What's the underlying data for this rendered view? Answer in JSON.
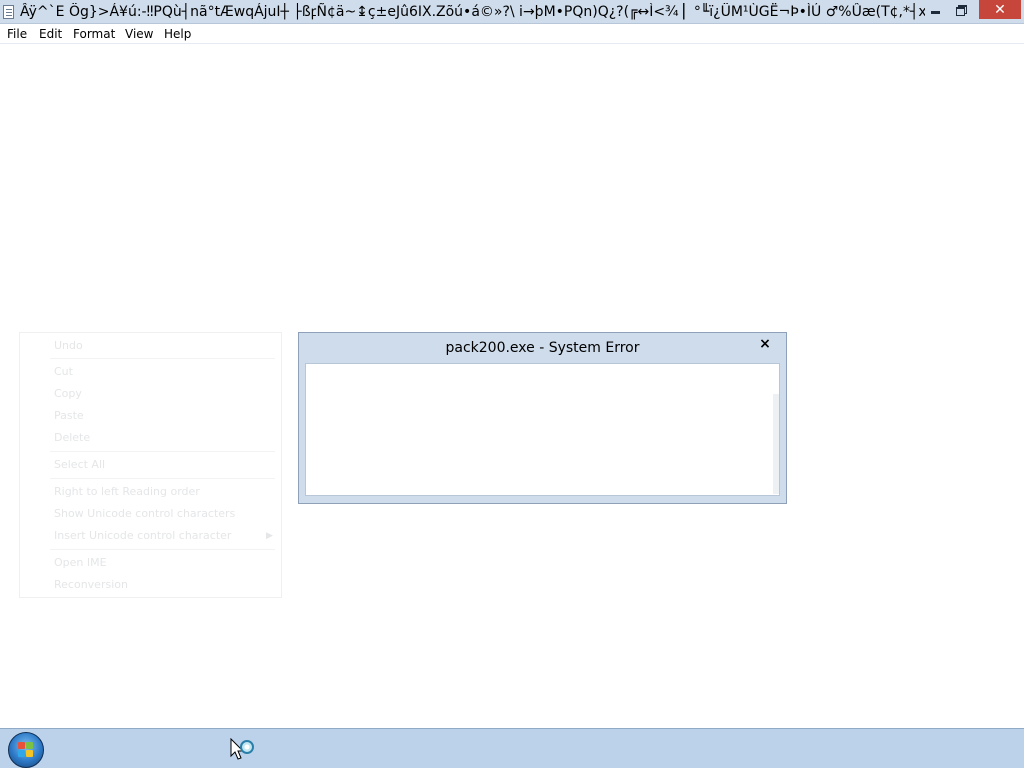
{
  "window": {
    "title": "Âÿ^`E Ög}>Á¥ú:-‼PQù┤nã°tÆwqÁjuI┼ ├ßꝼÑ¢ä~↨ç±eJû6IX.Zõú•á©»?\\ i→þM•PQn)Q¿?(╔↔Ì<¾ ▏°╙ï¿ÜM¹ÙGË¬Þ•ÌÚ ♂%Ûæ(T¢,*┤xómÓES...",
    "close_glyph": "✕"
  },
  "menubar": {
    "items": [
      "File",
      "Edit",
      "Format",
      "View",
      "Help"
    ]
  },
  "context_menu": {
    "items": [
      "Undo",
      "Cut",
      "Copy",
      "Paste",
      "Delete",
      "Select All",
      "Right to left Reading order",
      "Show Unicode control characters",
      "Insert Unicode control character",
      "Open IME",
      "Reconversion"
    ]
  },
  "dialog": {
    "title": "pack200.exe - System Error",
    "close_glyph": "×"
  },
  "taskbar": {
    "start_icon": "windows-logo-icon",
    "cursor_icon": "busy-cursor-icon"
  },
  "colors": {
    "titlebar": "#cfdceb",
    "close_button": "#c7463c",
    "taskbar": "#bcd2ea"
  }
}
